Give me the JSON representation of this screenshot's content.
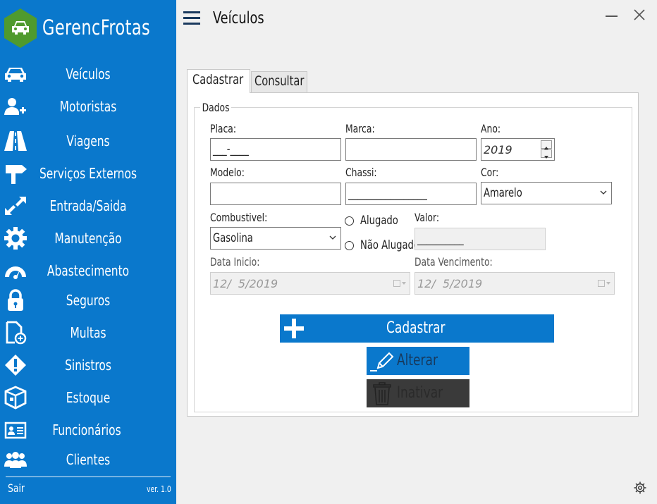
{
  "app": {
    "name": "GerencFrotas",
    "version": "ver. 1.0",
    "logout": "Sair"
  },
  "sidebar": {
    "items": [
      {
        "label": "Veículos",
        "icon": "car-icon"
      },
      {
        "label": "Motoristas",
        "icon": "add-user-icon"
      },
      {
        "label": "Viagens",
        "icon": "road-icon"
      },
      {
        "label": "Serviços Externos",
        "icon": "signpost-icon"
      },
      {
        "label": "Entrada/Saida",
        "icon": "expand-arrows-icon"
      },
      {
        "label": "Manutenção",
        "icon": "gear-icon"
      },
      {
        "label": "Abastecimento",
        "icon": "gauge-icon"
      },
      {
        "label": "Seguros",
        "icon": "lock-icon"
      },
      {
        "label": "Multas",
        "icon": "file-add-icon"
      },
      {
        "label": "Sinistros",
        "icon": "warning-diamond-icon"
      },
      {
        "label": "Estoque",
        "icon": "box-icon"
      },
      {
        "label": "Funcionários",
        "icon": "id-card-icon"
      },
      {
        "label": "Clientes",
        "icon": "users-icon"
      }
    ]
  },
  "header": {
    "title": "Veículos"
  },
  "tabs": [
    {
      "label": "Cadastrar",
      "active": true
    },
    {
      "label": "Consultar",
      "active": false
    }
  ],
  "form": {
    "group_title": "Dados",
    "placa": {
      "label": "Placa:",
      "value": "___-____"
    },
    "marca": {
      "label": "Marca:",
      "value": ""
    },
    "ano": {
      "label": "Ano:",
      "value": "2019"
    },
    "modelo": {
      "label": "Modelo:",
      "value": ""
    },
    "chassi": {
      "label": "Chassi:",
      "value": "_________________"
    },
    "cor": {
      "label": "Cor:",
      "value": "Amarelo"
    },
    "combustivel": {
      "label": "Combustivel:",
      "value": "Gasolina"
    },
    "alugado": {
      "label": "Alugado"
    },
    "nao_alugado": {
      "label": "Não Alugado"
    },
    "valor": {
      "label": "Valor:",
      "value": "__________"
    },
    "data_inicio": {
      "label": "Data Inicio:",
      "value": "12/  5/2019"
    },
    "data_vencimento": {
      "label": "Data Vencimento:",
      "value": "12/  5/2019"
    }
  },
  "buttons": {
    "cadastrar": "Cadastrar",
    "alterar": "Alterar",
    "inativar": "Inativar"
  },
  "colors": {
    "sidebar": "#0a78cc",
    "brand_icon": "#4f9a2e",
    "primary_button": "#0a78cc",
    "inactive_button": "#3a3a3a"
  }
}
